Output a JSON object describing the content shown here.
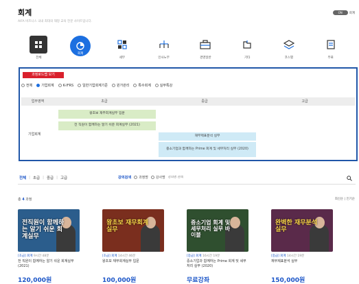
{
  "header": {
    "title": "회계",
    "subtitle": "AIFA 비즈니스 국내 최대의 재정 교육 전문 사이트입니다."
  },
  "toggle": {
    "label": "회계",
    "pill": "ON"
  },
  "categories": [
    {
      "label": "전체",
      "icon": "grid-icon"
    },
    {
      "label": "회계",
      "icon": "pie-chart-icon"
    },
    {
      "label": "세무",
      "icon": "tax-icon"
    },
    {
      "label": "인사노무",
      "icon": "org-chart-icon"
    },
    {
      "label": "경영일반",
      "icon": "briefcase-icon"
    },
    {
      "label": "기타",
      "icon": "folder-icon"
    },
    {
      "label": "코스별",
      "icon": "layers-icon"
    },
    {
      "label": "무료",
      "icon": "document-icon"
    }
  ],
  "roadmap": {
    "button": "과정로드맵 보기",
    "filters": [
      "전체",
      "기업회계",
      "K-IFRS",
      "일반기업회계기준",
      "원가관리",
      "특수회계",
      "실무특강"
    ],
    "selected_filter": "기업회계",
    "columns": [
      "업무영역",
      "초급",
      "중급",
      "고급"
    ],
    "row_label": "기업회계",
    "cells": [
      {
        "text": "왕초보 재무회계실무 입문"
      },
      {
        "text": "전 직원이 함께하는 알기 쉬운 회계실무 (2021)"
      },
      {
        "text": "재무제표분석 실무"
      },
      {
        "text": "중소기업과 함께하는 Prime 회계 및 세무처리 실무 (2020)"
      }
    ]
  },
  "level_tabs": [
    "전체",
    "초급",
    "중급",
    "고급"
  ],
  "search": {
    "label": "강의검색",
    "options": [
      "과정명",
      "강사명"
    ],
    "placeholder": "강의명 검색"
  },
  "count": {
    "prefix": "총",
    "value": "4",
    "suffix": "과정"
  },
  "sort": "최신순 | 인기순",
  "courses": [
    {
      "thumb_text": "전직원이 함께하는 알기 쉬운 회계실무",
      "level": "[초급] 회계",
      "meta": "9시간 48분",
      "title": "전 직원이 함께하는 알기 쉬운 회계실무 (2021)",
      "price": "120,000원",
      "bg": "#2b5d8c"
    },
    {
      "thumb_text": "왕초보 재무회계실무",
      "level": "[초급] 회계",
      "meta": "14시간 46분",
      "title": "왕초보 재무회계실무 입문",
      "price": "100,000원",
      "bg": "#7a2e1e"
    },
    {
      "thumb_text": "중소기업 회계 및 세무처리 실무 바이블",
      "level": "[중급] 회계",
      "meta": "16시간 19분",
      "title": "중소기업과 함께하는 Prime 회계 및 세무처리 실무 (2020)",
      "price": "무료강좌",
      "bg": "#2f4f2f"
    },
    {
      "thumb_text": "완벽한 재무분석실무",
      "level": "[중급] 회계",
      "meta": "14시간 19분",
      "title": "재무제표분석 실무",
      "price": "150,000원",
      "bg": "#5a2a4a"
    }
  ]
}
